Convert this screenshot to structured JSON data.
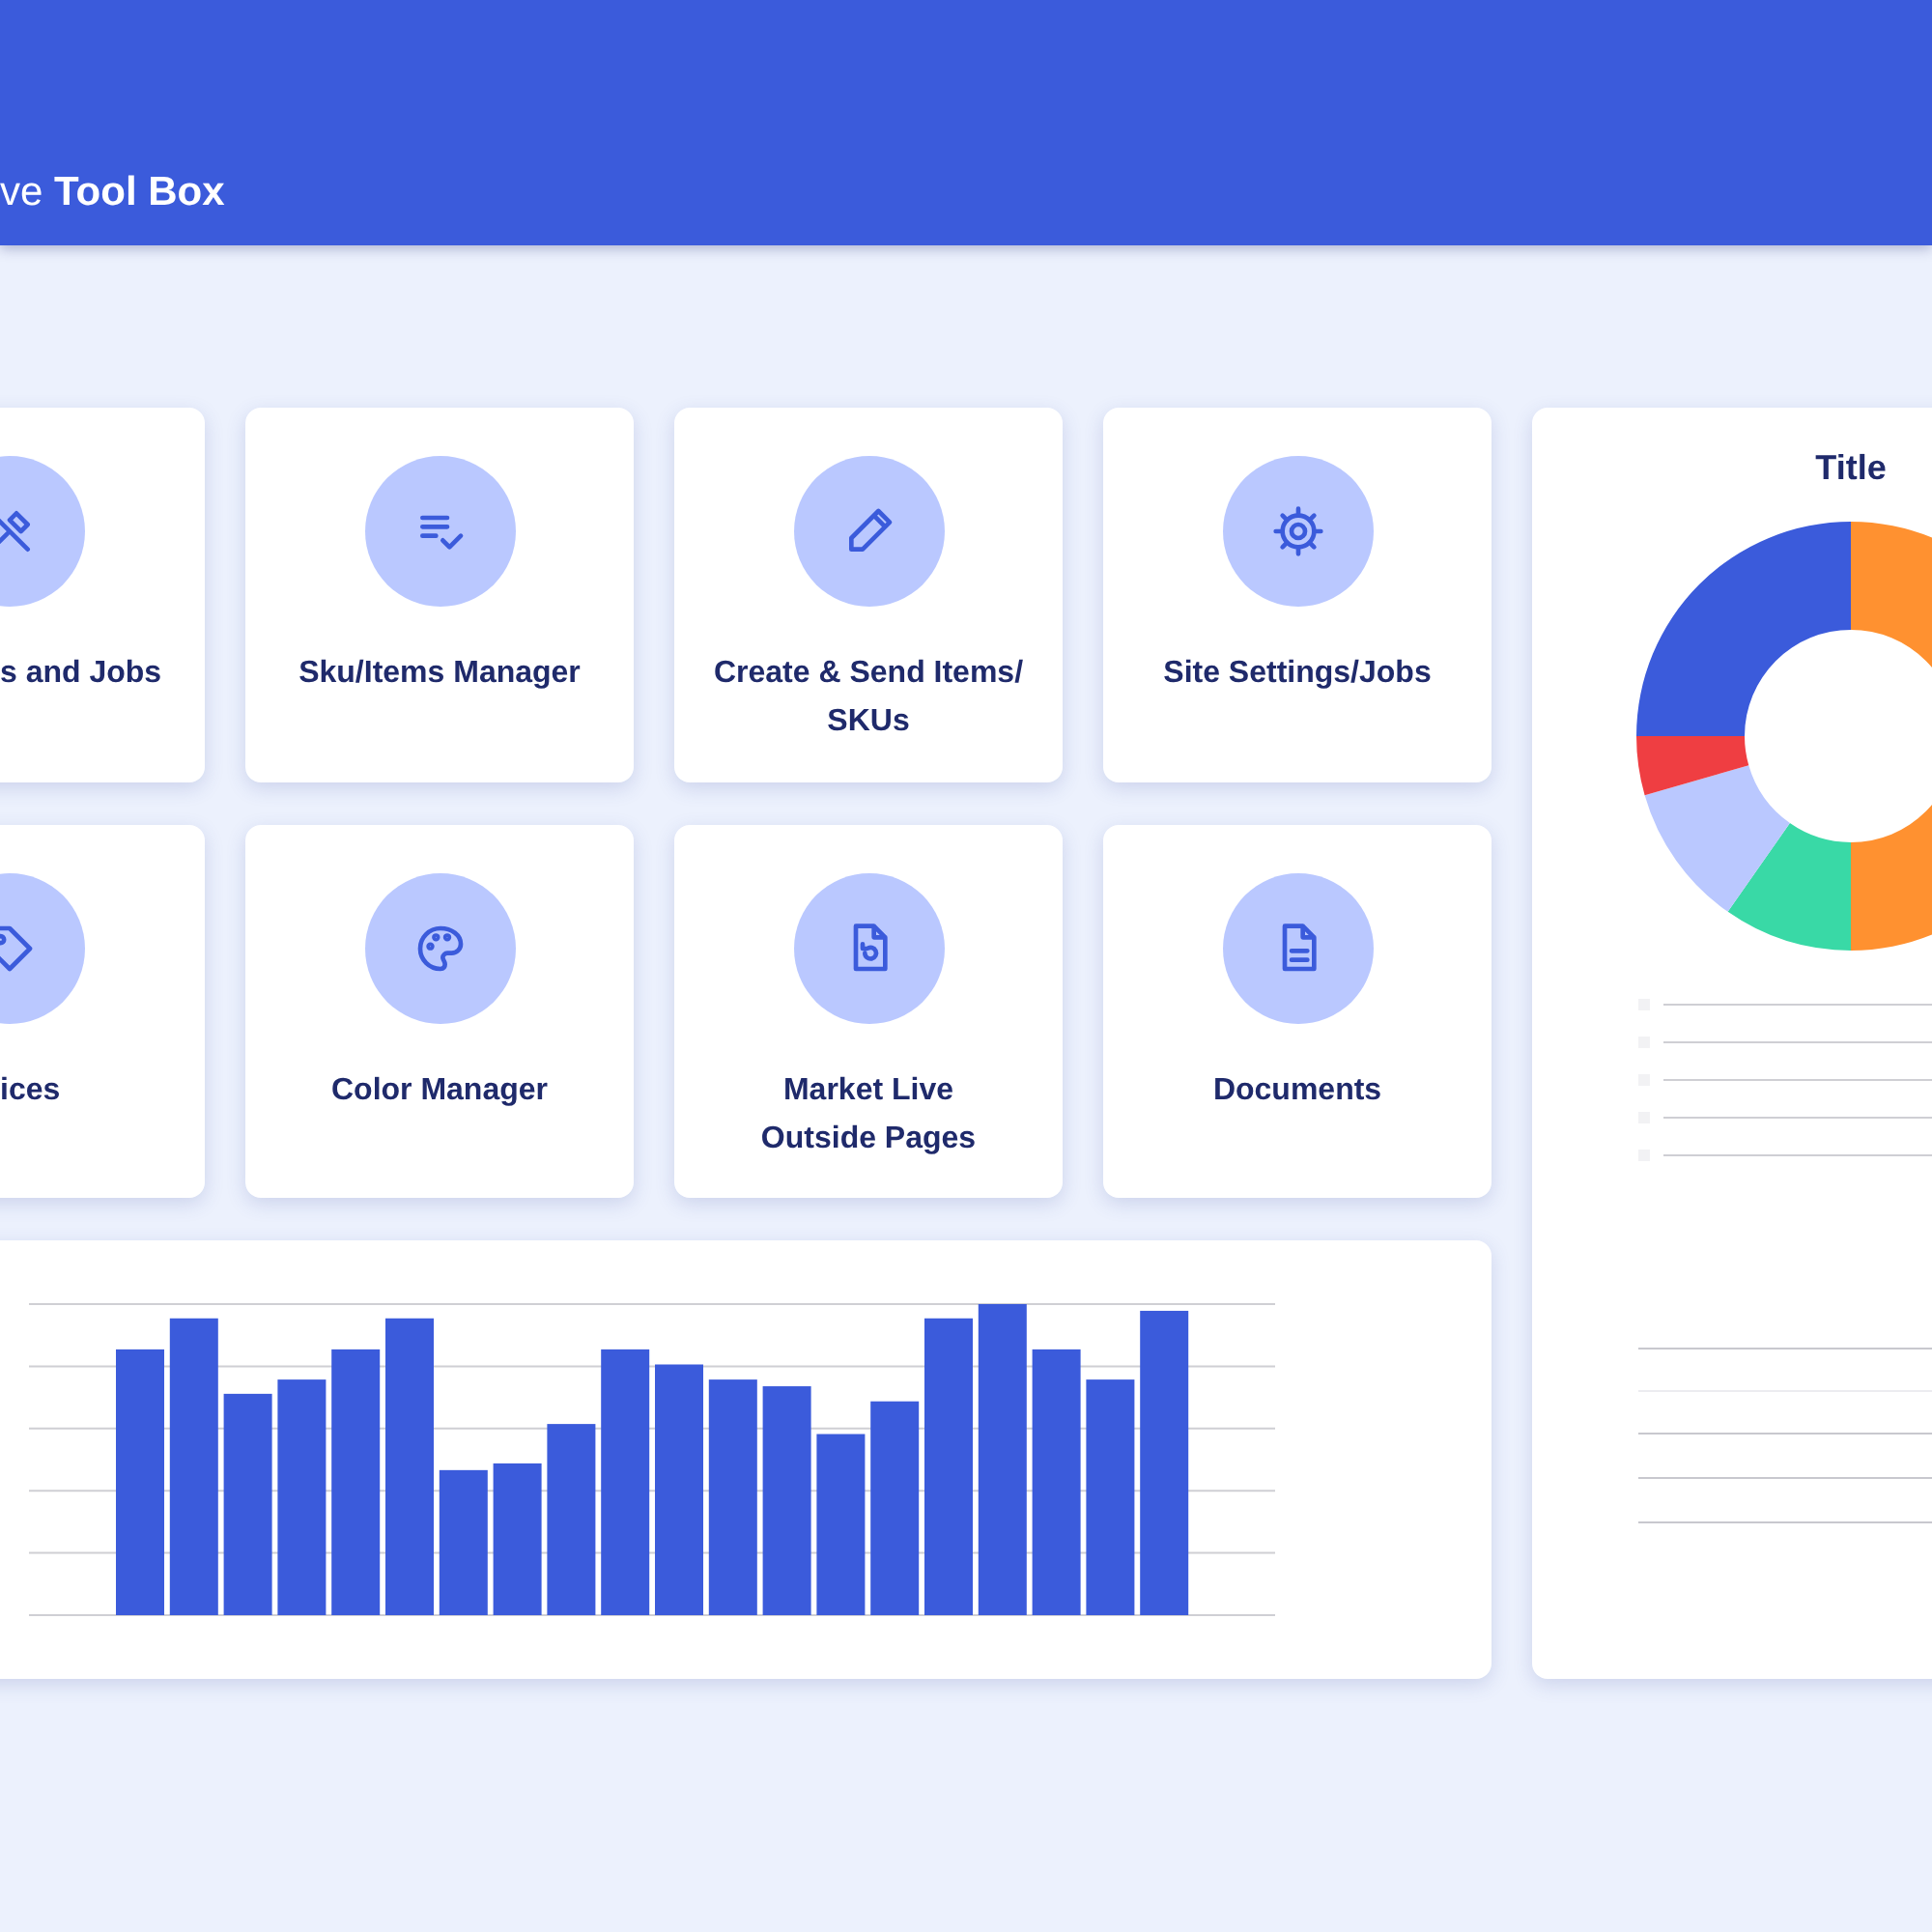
{
  "header": {
    "title": "ve **Tool Box**"
  },
  "tools": [
    {
      "lines": [
        "s and Jobs"
      ]
    },
    {
      "lines": [
        "Sku/Items Manager"
      ]
    },
    {
      "lines": [
        "Create & Send Items/",
        "SKUs"
      ]
    },
    {
      "lines": [
        "Site Settings/Jobs"
      ]
    },
    {
      "lines": [
        "ices"
      ]
    },
    {
      "lines": [
        "Color Manager"
      ]
    },
    {
      "lines": [
        "Market Live",
        "Outside Pages"
      ]
    },
    {
      "lines": [
        "Documents"
      ]
    }
  ],
  "donut_panel": {
    "title": "Title"
  }
}
